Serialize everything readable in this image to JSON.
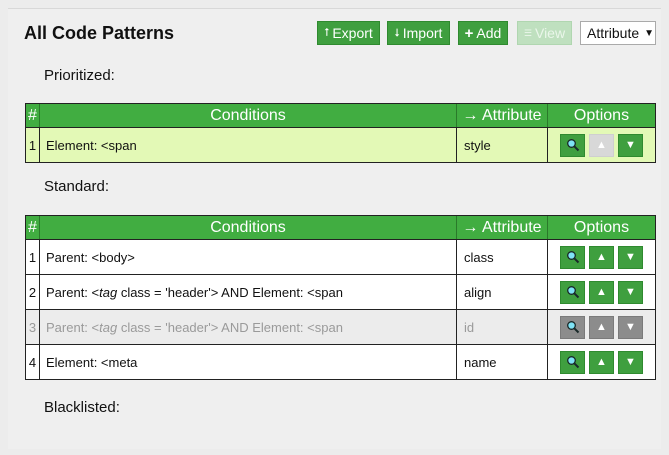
{
  "header": {
    "title": "All Code Patterns",
    "export_label": "Export",
    "import_label": "Import",
    "add_label": "Add",
    "view_label": "View",
    "mode_select": "Attribute"
  },
  "sections": {
    "prioritized": "Prioritized:",
    "standard": "Standard:",
    "blacklisted": "Blacklisted:"
  },
  "columns": {
    "num": "#",
    "conditions": "Conditions",
    "attribute": "→ Attribute",
    "options": "Options"
  },
  "prioritized_rows": [
    {
      "num": "1",
      "cond_pre": "Element: <span",
      "attr": "style"
    }
  ],
  "standard_rows": [
    {
      "num": "1",
      "cond_pre": "Parent: <body>",
      "attr": "class"
    },
    {
      "num": "2",
      "cond_pre": "Parent: <",
      "cond_tag": "tag",
      "cond_post": " class = 'header'> AND Element: <span",
      "attr": "align"
    },
    {
      "num": "3",
      "cond_pre": "Parent: <",
      "cond_tag": "tag",
      "cond_post": " class = 'header'> AND Element: <span",
      "attr": "id"
    },
    {
      "num": "4",
      "cond_pre": "Element: <meta",
      "attr": "name"
    }
  ],
  "icons": {
    "export": "export-arrow-icon",
    "import": "import-arrow-icon",
    "add": "plus-icon",
    "view": "list-icon",
    "search": "magnifier-icon",
    "up": "triangle-up-icon",
    "down": "triangle-down-icon"
  },
  "colors": {
    "accent_green": "#41ad41",
    "prioritized_row": "#e3f9b6",
    "disabled_row": "#ececec"
  }
}
